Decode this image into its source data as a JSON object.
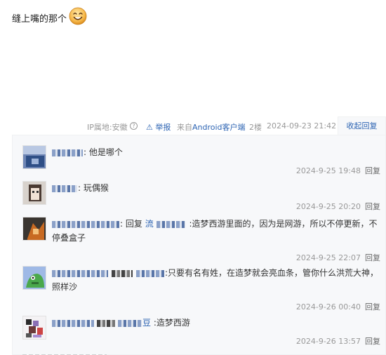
{
  "post": {
    "content": "缝上嘴的那个",
    "emoji": "smiley-face-emoji"
  },
  "meta": {
    "ip_location": "IP属地:安徽",
    "help_icon": "question-circle-icon",
    "report_label": "⚠ 举报",
    "from_prefix": "来自",
    "from_client": "Android客户端",
    "floor": "2楼",
    "time": "2024-09-23 21:42",
    "collapse_label": "收起回复"
  },
  "replies": [
    {
      "username_hidden": true,
      "text": ": 他是哪个",
      "time": "2024-9-25 19:48",
      "action": "回复"
    },
    {
      "username_hidden": true,
      "text": ": 玩偶猴",
      "time": "2024-9-25 20:20",
      "action": "回复"
    },
    {
      "username_hidden": true,
      "reply_prefix": ": 回复 ",
      "reply_to_visible": "流",
      "text": " :造梦西游里面的，因为是网游，所以不停更新，不停叠盒子",
      "time": "2024-9-25 22:07",
      "action": "回复"
    },
    {
      "username_hidden": true,
      "text": ":只要有名有姓，在造梦就会亮血条，管你什么洪荒大神，照样沙",
      "time": "2024-9-26 00:40",
      "action": "回复"
    },
    {
      "username_hidden": true,
      "username_tail": "豆",
      "text": " :造梦西游",
      "time": "2024-9-26 13:57",
      "action": "回复"
    }
  ],
  "colors": {
    "link": "#2d64b3",
    "meta": "#999999",
    "reply_bg": "#f7f8fa"
  }
}
